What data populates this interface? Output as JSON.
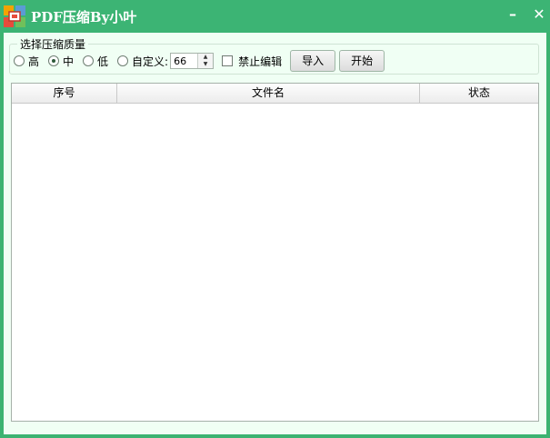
{
  "window": {
    "title": "PDF压缩By小叶",
    "minimize_glyph": "–",
    "close_glyph": "✕"
  },
  "group": {
    "legend": "选择压缩质量"
  },
  "quality_options": [
    {
      "label": "高",
      "checked": false
    },
    {
      "label": "中",
      "checked": true
    },
    {
      "label": "低",
      "checked": false
    },
    {
      "label": "自定义:",
      "checked": false
    }
  ],
  "custom_value": "66",
  "disable_edit_label": "禁止编辑",
  "buttons": {
    "import": "导入",
    "start": "开始"
  },
  "table": {
    "columns": [
      "序号",
      "文件名",
      "状态"
    ]
  },
  "colors": {
    "titlebar": "#3cb474",
    "content_bg": "#f0fff4"
  },
  "icons": [
    "app-logo-icon",
    "minimize-icon",
    "close-icon",
    "spin-up-icon",
    "spin-down-icon"
  ]
}
